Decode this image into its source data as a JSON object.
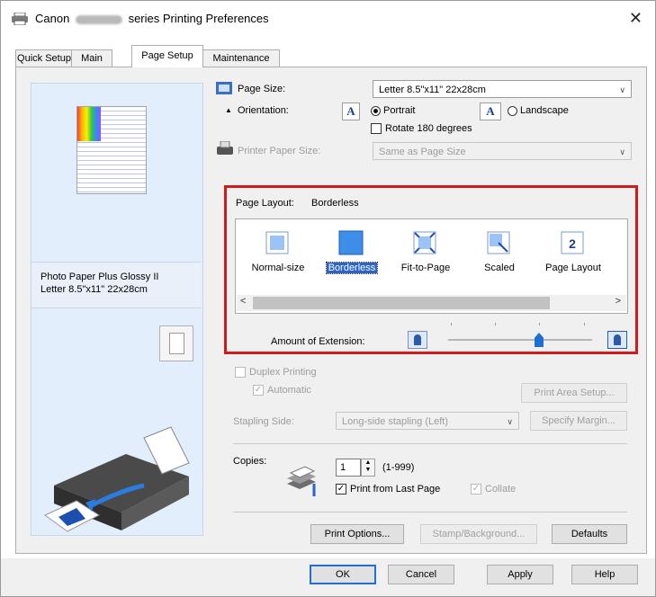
{
  "window": {
    "title_prefix": "Canon",
    "title_suffix": "series Printing Preferences",
    "close_glyph": "✕"
  },
  "tabs": [
    {
      "label": "Quick Setup",
      "active": false
    },
    {
      "label": "Main",
      "active": false
    },
    {
      "label": "Page Setup",
      "active": true
    },
    {
      "label": "Maintenance",
      "active": false
    }
  ],
  "preview": {
    "media_line1": "Photo Paper Plus Glossy II",
    "media_line2": "Letter 8.5\"x11\" 22x28cm"
  },
  "page_size": {
    "label": "Page Size:",
    "value": "Letter 8.5\"x11\" 22x28cm"
  },
  "orientation": {
    "label": "Orientation:",
    "portrait": "Portrait",
    "landscape": "Landscape",
    "selected": "Portrait",
    "rotate_label": "Rotate 180 degrees",
    "rotate_checked": false
  },
  "printer_paper_size": {
    "label": "Printer Paper Size:",
    "value": "Same as Page Size"
  },
  "page_layout": {
    "label": "Page Layout:",
    "current": "Borderless",
    "items": [
      {
        "label": "Normal-size"
      },
      {
        "label": "Borderless"
      },
      {
        "label": "Fit-to-Page"
      },
      {
        "label": "Scaled"
      },
      {
        "label": "Page Layout"
      }
    ],
    "selected_index": 1,
    "scroll_left": "<",
    "scroll_right": ">",
    "extension_label": "Amount of Extension:",
    "extension_level_fraction": 0.66
  },
  "duplex": {
    "label": "Duplex Printing",
    "automatic_label": "Automatic",
    "automatic_checked": true,
    "print_area_button": "Print Area Setup...",
    "stapling_label": "Stapling Side:",
    "stapling_value": "Long-side stapling (Left)",
    "specify_margin_button": "Specify Margin..."
  },
  "copies": {
    "label": "Copies:",
    "value": "1",
    "range": "(1-999)",
    "print_last_label": "Print from Last Page",
    "print_last_checked": true,
    "collate_label": "Collate",
    "collate_checked": true
  },
  "panel_buttons": {
    "print_options": "Print Options...",
    "stamp_background": "Stamp/Background...",
    "defaults": "Defaults"
  },
  "dialog_buttons": {
    "ok": "OK",
    "cancel": "Cancel",
    "apply": "Apply",
    "help": "Help"
  },
  "colors": {
    "highlight_frame": "#d31a1a",
    "selection_blue": "#2b64c6",
    "preview_bg": "#e2eefb"
  }
}
